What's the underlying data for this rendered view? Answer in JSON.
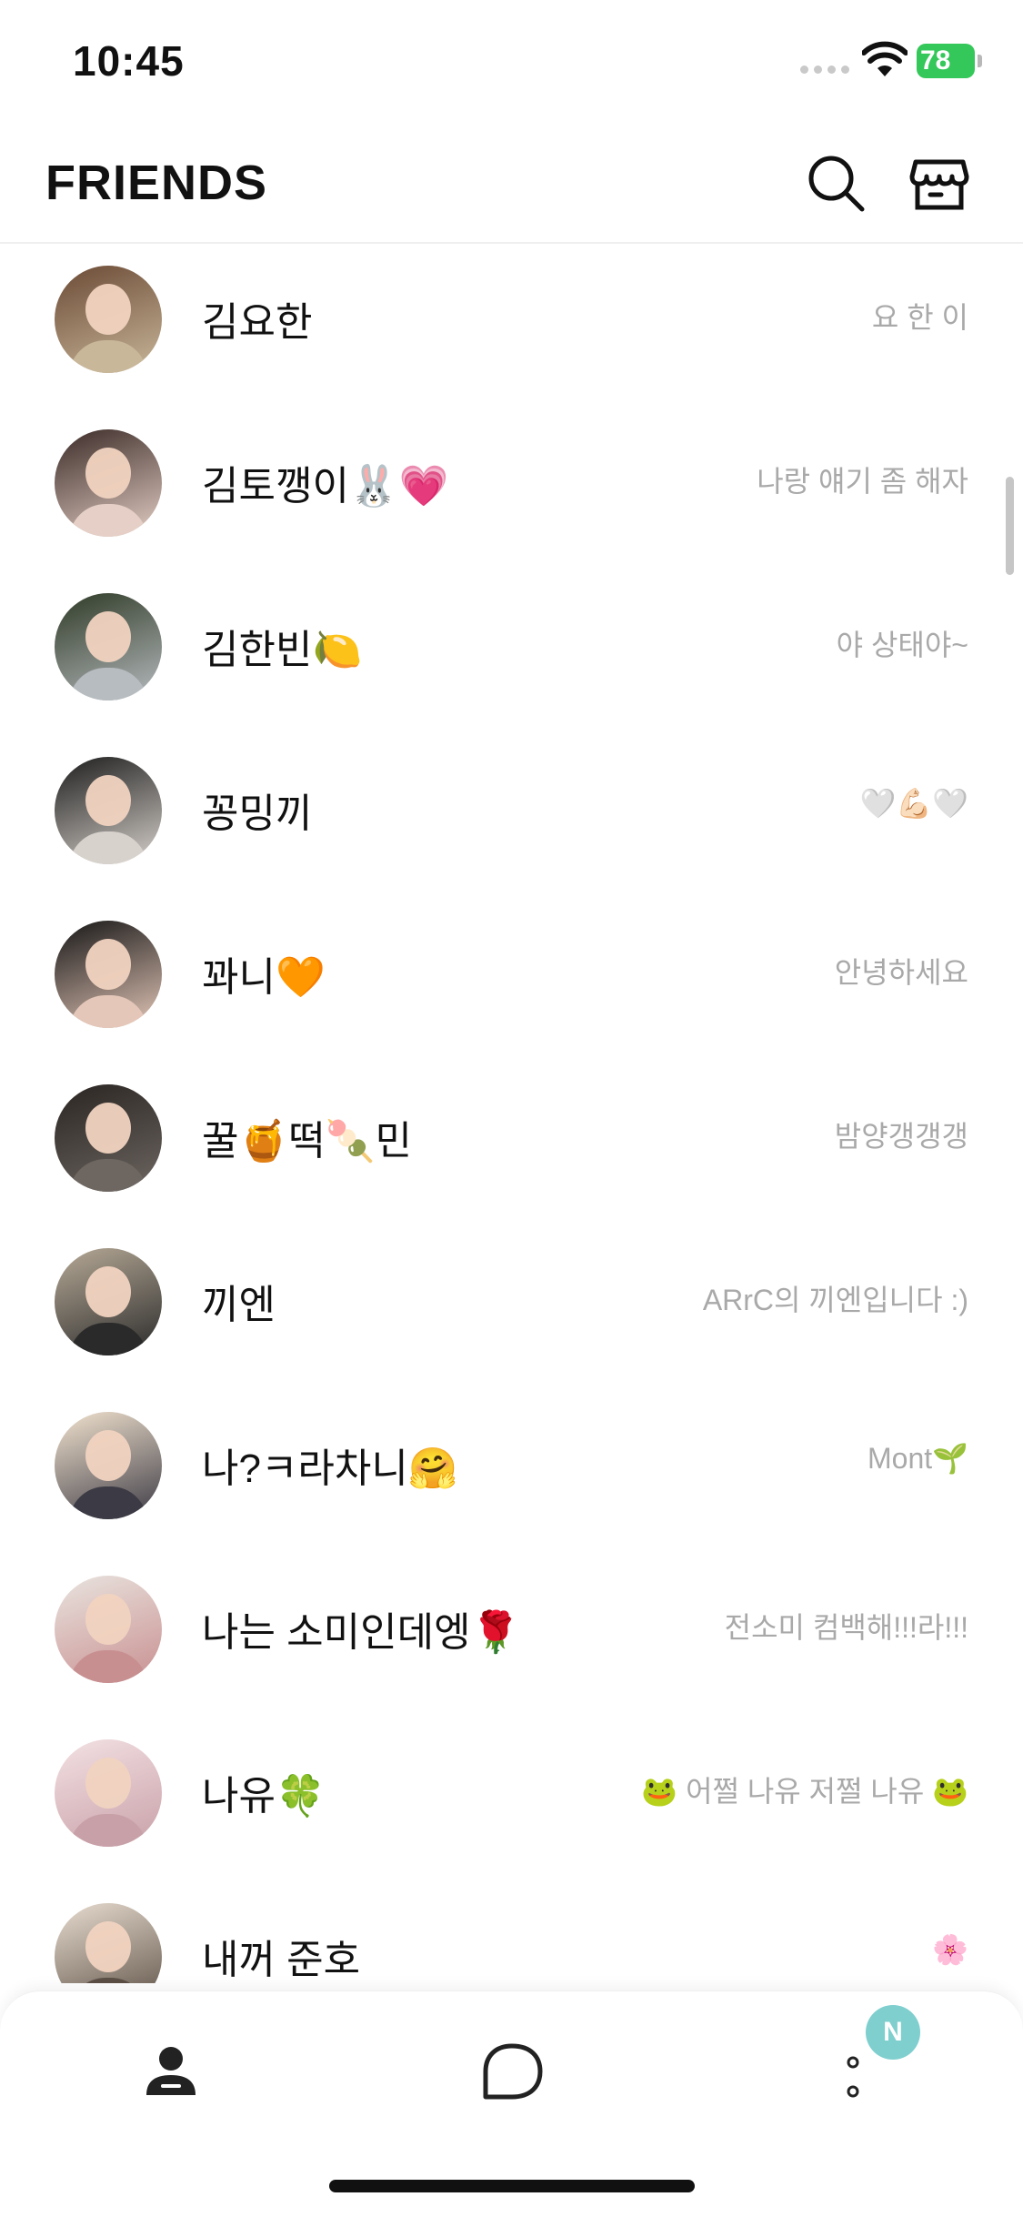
{
  "status_bar": {
    "time": "10:45",
    "battery": "78"
  },
  "header": {
    "title": "FRIENDS"
  },
  "icons": {
    "search": "search-icon",
    "shop": "shop-icon",
    "friends_tab": "person-icon",
    "chats_tab": "chat-bubble-icon",
    "more_tab": "more-icon"
  },
  "friends": [
    {
      "name": "김요한",
      "status": "요 한 이",
      "avatar_colors": [
        "#6b4a35",
        "#c9b79a"
      ]
    },
    {
      "name": "김토깽이🐰💗",
      "status": "나랑 얘기 좀 해자",
      "avatar_colors": [
        "#3a2a26",
        "#e5cfc6"
      ]
    },
    {
      "name": "김한빈🍋",
      "status": "야 상태야~",
      "avatar_colors": [
        "#2f3a26",
        "#b7bcc0"
      ]
    },
    {
      "name": "꽁밍끼",
      "status": "🤍💪🏻🤍",
      "avatar_colors": [
        "#1d1d1d",
        "#d8d2cc"
      ]
    },
    {
      "name": "꽈니🧡",
      "status": "안녕하세요",
      "avatar_colors": [
        "#161616",
        "#e4c7b8"
      ]
    },
    {
      "name": "꿀🍯떡🍡민",
      "status": "밤양갱갱갱",
      "avatar_colors": [
        "#2a2522",
        "#6d6661"
      ]
    },
    {
      "name": "끼엔",
      "status": "ARrC의 끼엔입니다 :)",
      "avatar_colors": [
        "#b7aa97",
        "#2a2a2a"
      ]
    },
    {
      "name": "나?ㅋ라차니🤗",
      "status": "Mont🌱",
      "avatar_colors": [
        "#f2e3cf",
        "#3c3a44"
      ]
    },
    {
      "name": "나는 소미인데엥🌹",
      "status": "전소미 컴백해!!!라!!!",
      "avatar_colors": [
        "#e9e4df",
        "#c88f90"
      ]
    },
    {
      "name": "나유🍀",
      "status": "🐸 어쩔 나유 저쩔 나유 🐸",
      "avatar_colors": [
        "#f3e1e3",
        "#c8a0a8"
      ]
    },
    {
      "name": "내꺼 준호",
      "status": "🌸",
      "avatar_colors": [
        "#e8ddd0",
        "#5c4f45"
      ]
    }
  ],
  "tab_bar": {
    "notification_badge": "N"
  }
}
